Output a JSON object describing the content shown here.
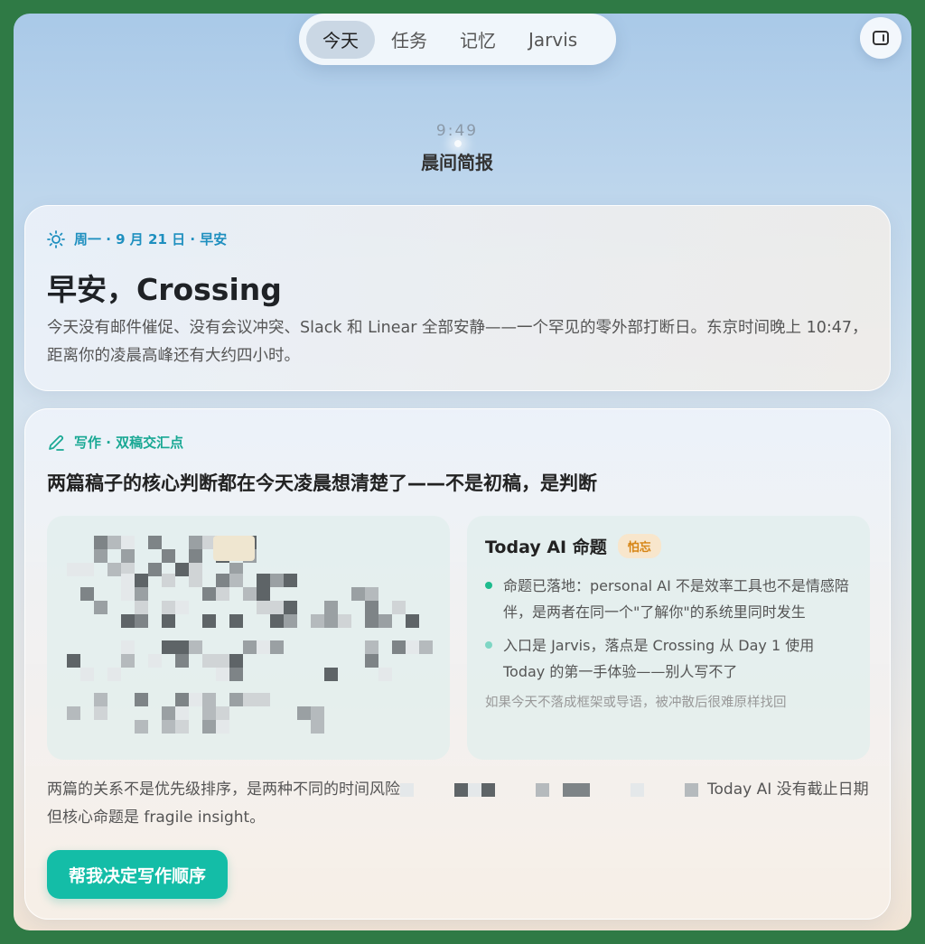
{
  "tabs": [
    {
      "label": "今天",
      "active": true
    },
    {
      "label": "任务",
      "active": false
    },
    {
      "label": "记忆",
      "active": false
    },
    {
      "label": "Jarvis",
      "active": false
    }
  ],
  "header": {
    "time": "9:49",
    "title": "晨间简报"
  },
  "greeting_card": {
    "eyebrow": "周一 · 9 月 21 日 · 早安",
    "icon": "sun-icon",
    "title": "早安，Crossing",
    "body": "今天没有邮件催促、没有会议冲突、Slack 和 Linear 全部安静——一个罕见的零外部打断日。东京时间晚上 10:47，距离你的凌晨高峰还有大约四小时。"
  },
  "writing_card": {
    "eyebrow": "写作 · 双稿交汇点",
    "icon": "pencil-icon",
    "headline": "两篇稿子的核心判断都在今天凌晨想清楚了——不是初稿，是判断",
    "right_panel": {
      "title": "Today AI 命题",
      "badge": "怕忘",
      "bullets": [
        "命题已落地：personal AI 不是效率工具也不是情感陪伴，是两者在同一个\"了解你\"的系统里同时发生",
        "入口是 Jarvis，落点是 Crossing 从 Day 1 使用 Today 的第一手体验——别人写不了"
      ],
      "note": "如果今天不落成框架或导语，被冲散后很难原样找回"
    },
    "relation_prefix": "两篇的关系不是优先级排序，是两种不同的时间风险",
    "relation_suffix": "Today AI 没有截止日期但核心命题是 fragile insight。",
    "cta": "帮我决定写作顺序"
  },
  "colors": {
    "accent_teal": "#14bda7",
    "accent_blue": "#1e8fbf",
    "badge_orange": "#d68515"
  }
}
